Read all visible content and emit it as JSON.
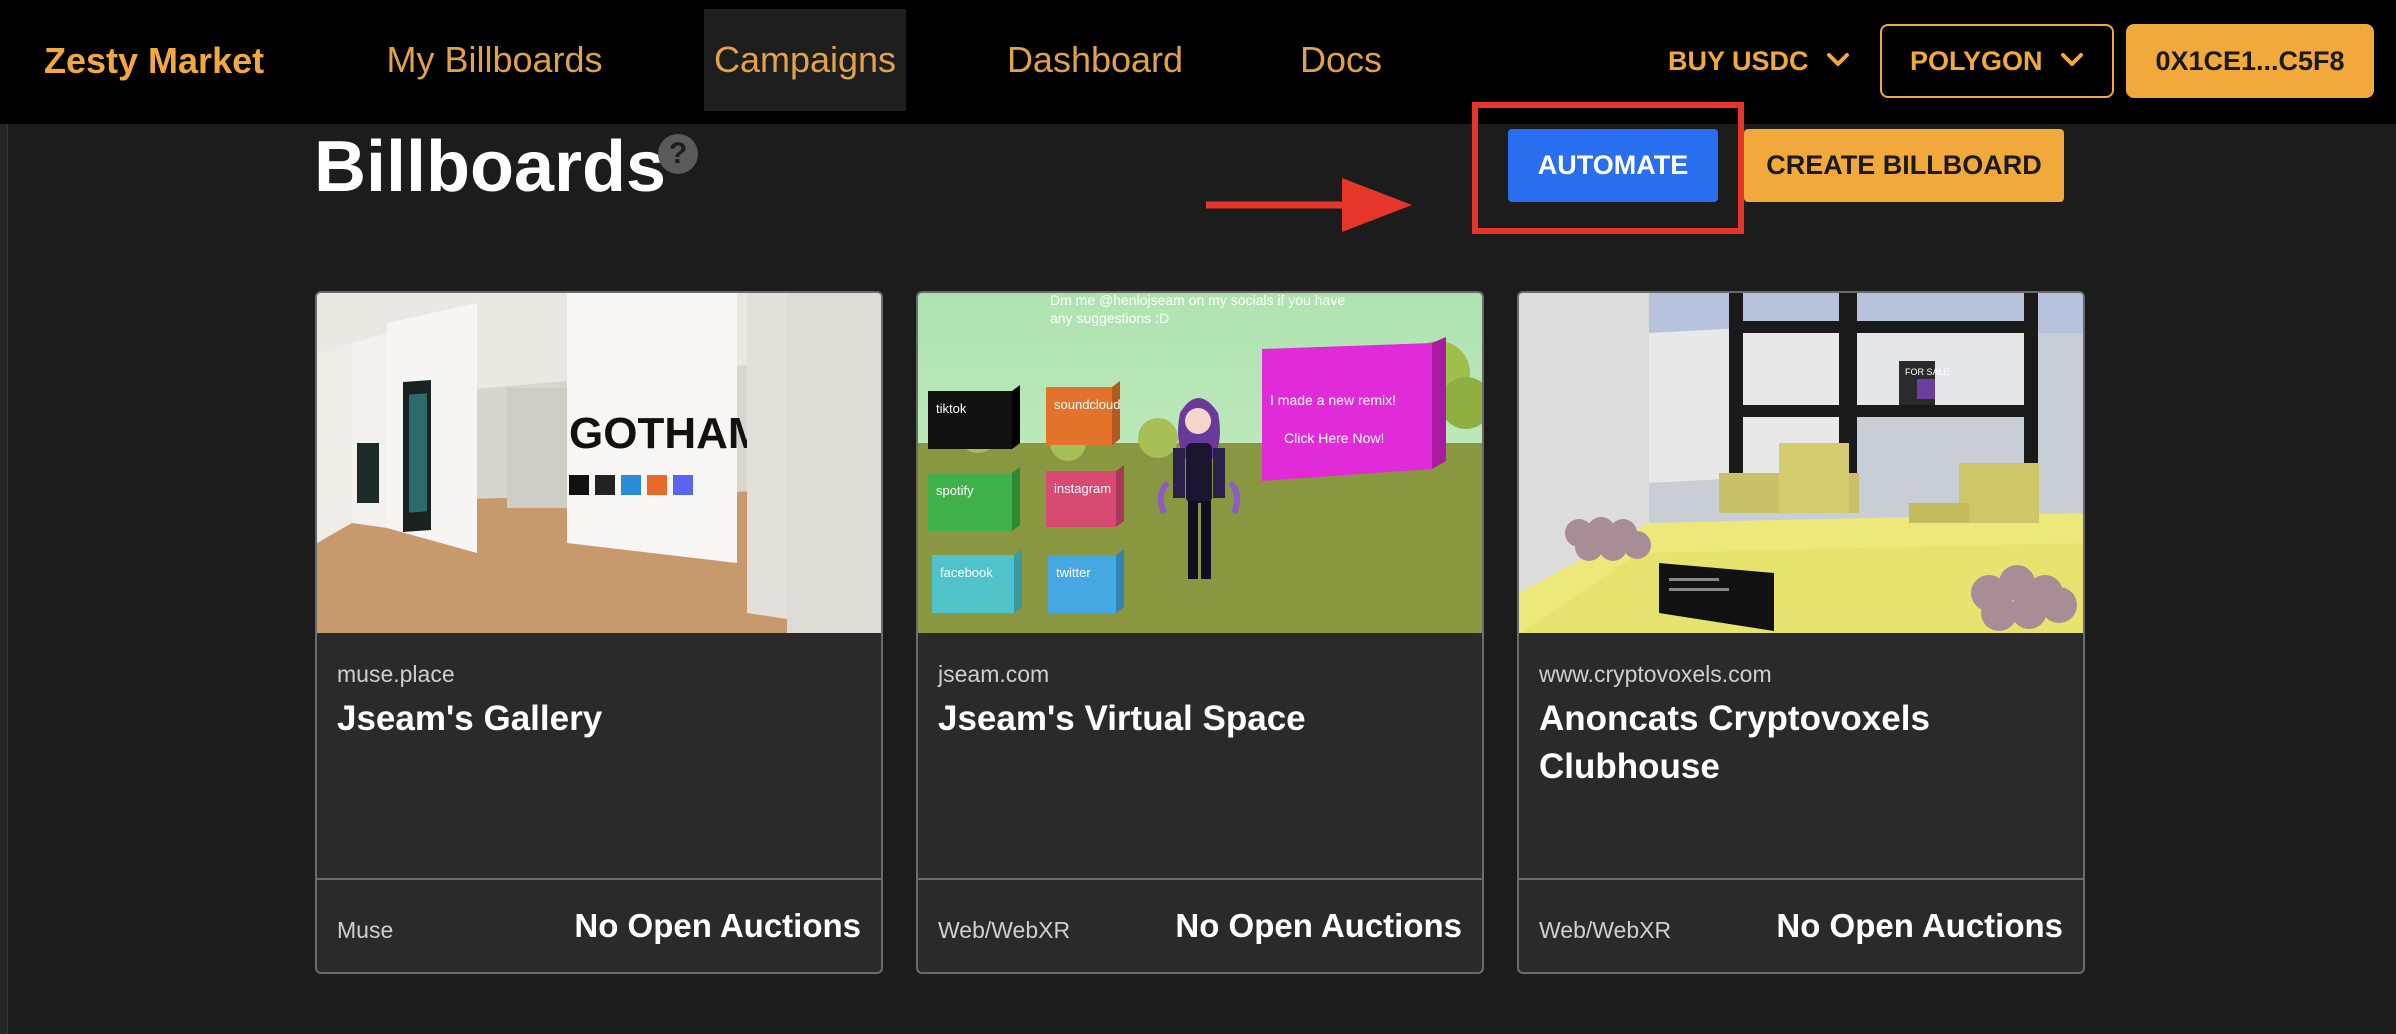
{
  "navbar": {
    "brand": "Zesty Market",
    "links": [
      {
        "label": "My Billboards",
        "active": false
      },
      {
        "label": "Campaigns",
        "active": true
      },
      {
        "label": "Dashboard",
        "active": false
      },
      {
        "label": "Docs",
        "active": false
      }
    ],
    "buy_usdc": "BUY USDC",
    "network": "POLYGON",
    "wallet": "0X1CE1...C5F8"
  },
  "page": {
    "title": "Billboards",
    "help_icon": "?",
    "automate_label": "AUTOMATE",
    "create_label": "CREATE BILLBOARD"
  },
  "cards": [
    {
      "domain": "muse.place",
      "title": "Jseam's Gallery",
      "type": "Muse",
      "status": "No Open Auctions",
      "image": {
        "sign": "GOTHAM"
      }
    },
    {
      "domain": "jseam.com",
      "title": "Jseam's Virtual Space",
      "type": "Web/WebXR",
      "status": "No Open Auctions",
      "image": {
        "caption_line1": "Dm me @henlojseam on my socials if you have",
        "caption_line2": "any suggestions :D",
        "boxes": [
          "tiktok",
          "soundcloud",
          "spotify",
          "instagram",
          "facebook",
          "twitter"
        ],
        "remix_line1": "I made a new remix!",
        "remix_line2": "Click Here Now!"
      }
    },
    {
      "domain": "www.cryptovoxels.com",
      "title": "Anoncats Cryptovoxels Clubhouse",
      "type": "Web/WebXR",
      "status": "No Open Auctions",
      "image": {
        "sign": "FOR SALE"
      }
    }
  ],
  "colors": {
    "accent": "#f2a93b",
    "automate": "#2a6ef0",
    "annotation": "#e6352b",
    "background": "#1c1c1c"
  }
}
